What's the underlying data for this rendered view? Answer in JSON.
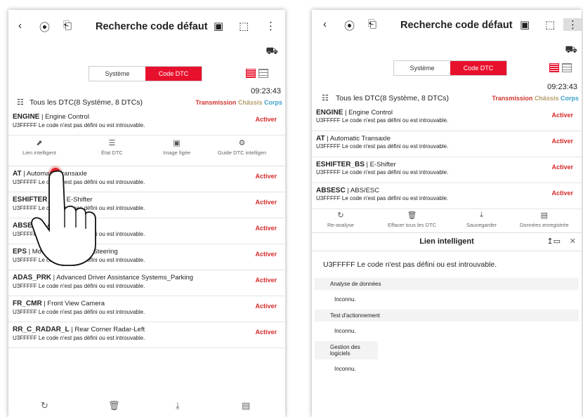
{
  "header": {
    "title": "Recherche code défaut"
  },
  "tabs": {
    "system": "Système",
    "dtc": "Code DTC"
  },
  "time": "09:23:43",
  "filter": {
    "all_left": "Tous les DTC(8 Système, 8 DTCs)",
    "all_right": "Tous les DTC(8 Système, 8 DTCs)",
    "transmission": "Transmission",
    "chassis": "Châssis",
    "corps": "Corps"
  },
  "left_dtcs": [
    {
      "code": "ENGINE",
      "system": "Engine Control",
      "desc": "U3FFFFF Le code n'est pas défini ou est introuvable.",
      "action": "Activer"
    },
    {
      "code": "AT",
      "system": "Automatic Transaxle",
      "desc": "U3FFFFF Le code n'est pas défini ou est introuvable.",
      "action": "Activer"
    },
    {
      "code": "ESHIFTER_BS",
      "system": "E-Shifter",
      "desc": "U3FFFFF Le code n'est pas défini ou est introuvable.",
      "action": "Activer"
    },
    {
      "code": "ABSESC",
      "system": "ABS/ESC",
      "desc": "U3FFFFF Le code n'est pas défini ou est introuvable.",
      "action": "Activer"
    },
    {
      "code": "EPS",
      "system": "Motor Driven Power Steering",
      "desc": "U3FFFFF Le code n'est pas défini ou est introuvable.",
      "action": "Activer"
    },
    {
      "code": "ADAS_PRK",
      "system": "Advanced Driver Assistance Systems_Parking",
      "desc": "U3FFFFF Le code n'est pas défini ou est introuvable.",
      "action": "Activer"
    },
    {
      "code": "FR_CMR",
      "system": "Front View Camera",
      "desc": "U3FFFFF Le code n'est pas défini ou est introuvable.",
      "action": "Activer"
    },
    {
      "code": "RR_C_RADAR_L",
      "system": "Rear Corner Radar-Left",
      "desc": "U3FFFFF Le code n'est pas défini ou est introuvable.",
      "action": "Activer"
    }
  ],
  "left_actions": {
    "smart_link": "Lien intelligent",
    "dtc_state": "État DTC",
    "freeze_frame": "Image figée",
    "smart_guide": "Guide DTC intelligen"
  },
  "right_dtcs": [
    {
      "code": "ENGINE",
      "system": "Engine Control",
      "desc": "U3FFFFF Le code n'est pas défini ou est introuvable.",
      "action": "Activer"
    },
    {
      "code": "AT",
      "system": "Automatic Transaxle",
      "desc": "U3FFFFF Le code n'est pas défini ou est introuvable.",
      "action": "Activer"
    },
    {
      "code": "ESHIFTER_BS",
      "system": "E-Shifter",
      "desc": "U3FFFFF Le code n'est pas défini ou est introuvable.",
      "action": "Activer"
    },
    {
      "code": "ABSESC",
      "system": "ABS/ESC",
      "desc": "U3FFFFF Le code n'est pas défini ou est introuvable.",
      "action": "Activer"
    }
  ],
  "right_toolbar": {
    "reanalyse": "Re-analyse",
    "clear_all": "Effacer tous les DTC",
    "save": "Sauvegarder",
    "saved_data": "Données enregistrée"
  },
  "lien": {
    "title": "Lien intelligent",
    "code_desc": "U3FFFFF Le code n'est pas défini ou est introuvable.",
    "sections": [
      {
        "label": "Analyse de données",
        "value": "Inconnu."
      },
      {
        "label": "Test d'actionnement",
        "value": "Inconnu."
      },
      {
        "label": "Gestion des logiciels",
        "value": "Inconnu."
      }
    ]
  },
  "icons": {
    "back": "chevron-left-icon",
    "more": "more-vertical-icon",
    "car": "car-settings-icon"
  },
  "colors": {
    "accent": "#e8112d",
    "activer": "#d62a2a",
    "transmission": "#d0342c",
    "chassis": "#b5a06a",
    "corps": "#3fa0c9"
  }
}
